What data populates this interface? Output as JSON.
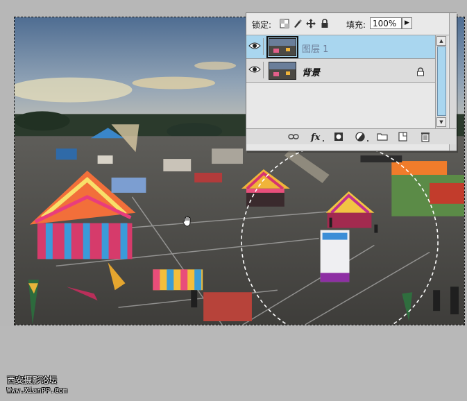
{
  "layers_panel": {
    "lock_label": "锁定:",
    "fill_label": "填充:",
    "fill_value": "100%",
    "lock_icons": [
      "lock-transparent-pixels-icon",
      "lock-image-pixels-icon",
      "lock-position-icon",
      "lock-all-icon"
    ],
    "layers": [
      {
        "name": "图层 1",
        "selected": true,
        "visible": true
      },
      {
        "name": "背景",
        "selected": false,
        "visible": true,
        "locked": true
      }
    ],
    "footer_icons": [
      "link-layers-icon",
      "layer-style-fx-icon",
      "add-mask-icon",
      "adjustment-layer-icon",
      "new-group-folder-icon",
      "new-layer-icon",
      "delete-layer-trash-icon"
    ]
  },
  "canvas": {
    "selection": "circular-marquee",
    "cursor": "hand-tool-icon"
  },
  "watermark": {
    "line1": "西安摄影论坛",
    "line2": "Www.XianPP.Com"
  }
}
